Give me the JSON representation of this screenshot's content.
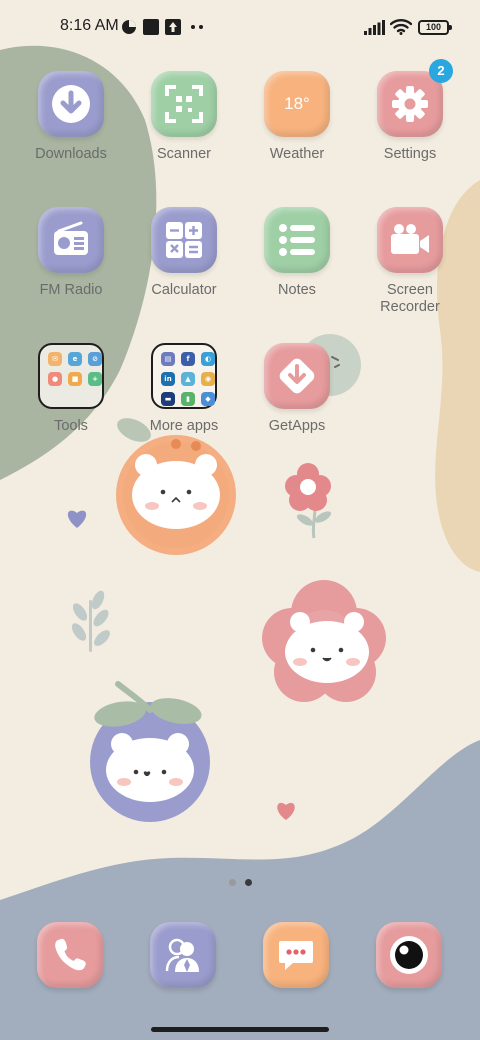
{
  "status_bar": {
    "time": "8:16 AM",
    "battery": "100",
    "icons": [
      "notification-badge-icon",
      "square-app-icon",
      "upload-icon",
      "more-dots-icon",
      "signal-icon",
      "wifi-icon",
      "battery-icon"
    ]
  },
  "apps": [
    {
      "label": "Downloads",
      "icon": "download-icon",
      "color": "#9a9ccd"
    },
    {
      "label": "Scanner",
      "icon": "scan-icon",
      "color": "#9fcfa5"
    },
    {
      "label": "Weather",
      "icon": "weather-icon",
      "color": "#f7b27d",
      "temp": "18°"
    },
    {
      "label": "Settings",
      "icon": "gear-icon",
      "color": "#e69b9d",
      "badge": "2"
    },
    {
      "label": "FM Radio",
      "icon": "radio-icon",
      "color": "#9a9ccd"
    },
    {
      "label": "Calculator",
      "icon": "calculator-icon",
      "color": "#9a9ccd"
    },
    {
      "label": "Notes",
      "icon": "list-icon",
      "color": "#9fcfa5"
    },
    {
      "label": "Screen\nRecorder",
      "icon": "video-camera-icon",
      "color": "#e69b9d"
    },
    {
      "label": "Tools",
      "icon": "folder-icon"
    },
    {
      "label": "More apps",
      "icon": "folder-icon"
    },
    {
      "label": "GetApps",
      "icon": "getapps-icon",
      "color": "#e69b9d"
    }
  ],
  "folders": {
    "tools": [
      "#f3b36b",
      "#56a7d9",
      "#5a9fd8",
      "#f08a7b",
      "#f1a94e",
      "#5bbd86"
    ],
    "more_apps": [
      "#6d7bbf",
      "#3d5ea8",
      "#3aa0d8",
      "#1c6fb0",
      "#5bb3d8",
      "#e8b04a",
      "#1d3e7a",
      "#59b36a",
      "#4c8fd8"
    ]
  },
  "page_indicator": {
    "count": 2,
    "active": 2
  },
  "dock": [
    {
      "name": "phone",
      "icon": "phone-icon",
      "color": "#e69b9d"
    },
    {
      "name": "contacts",
      "icon": "contacts-icon",
      "color": "#9a9ccd"
    },
    {
      "name": "messages",
      "icon": "message-icon",
      "color": "#f7b27d"
    },
    {
      "name": "camera",
      "icon": "camera-icon",
      "color": "#e69b9d"
    }
  ]
}
